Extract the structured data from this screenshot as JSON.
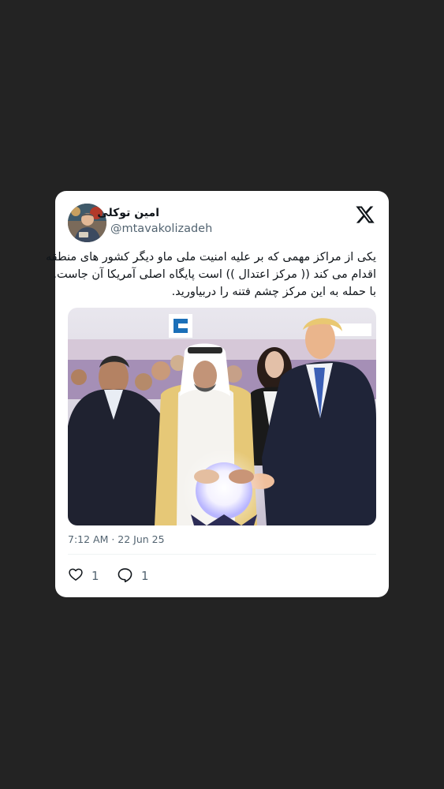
{
  "tweet": {
    "author": {
      "display_name": "امین توکلی",
      "handle": "@mtavakolizadeh"
    },
    "brand_icon": "x-logo-icon",
    "text_lines": [
      "یکی از مراکز مهمی که بر علیه امنیت ملی ماو دیگر کشور های منطقه",
      "اقدام می کند (( مرکز اعتدال )) است پایگاه اصلی آمریکا آن جاست.",
      "با حمله به این مرکز چشم فتنه را دربیاورید."
    ],
    "timestamp": "7:12 AM · 22 Jun 25",
    "actions": {
      "like": {
        "icon": "heart-icon",
        "count": "1"
      },
      "reply": {
        "icon": "reply-icon",
        "count": "1"
      }
    }
  },
  "colors": {
    "page_background": "#232323",
    "card_background": "#ffffff",
    "primary_text": "#0f1419",
    "secondary_text": "#536471"
  }
}
